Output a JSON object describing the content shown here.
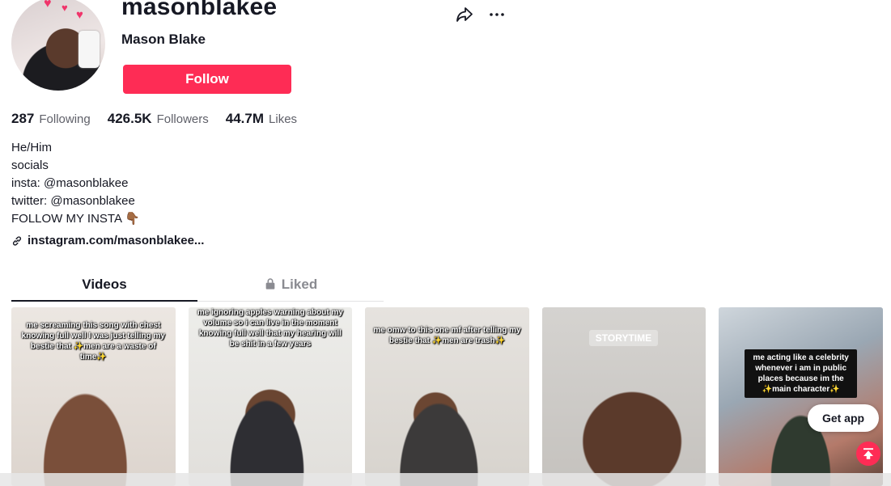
{
  "profile": {
    "username": "masonblakee",
    "nickname": "Mason Blake",
    "follow_label": "Follow"
  },
  "stats": {
    "following_count": "287",
    "following_label": "Following",
    "followers_count": "426.5K",
    "followers_label": "Followers",
    "likes_count": "44.7M",
    "likes_label": "Likes"
  },
  "bio": {
    "lines": [
      "He/Him",
      "socials",
      "insta: @masonblakee",
      "twitter: @masonblakee",
      "FOLLOW MY INSTA 👇🏾"
    ],
    "link": "instagram.com/masonblakee..."
  },
  "tabs": {
    "videos": "Videos",
    "liked": "Liked"
  },
  "videos": [
    {
      "caption": "me screaming this song with chest knowing full well I was just telling my bestie that ✨men are a waste of time✨"
    },
    {
      "caption": "me ignoring apples warning about my volume so i can live in the moment knowing full well that my hearing will be shit in a few years"
    },
    {
      "caption": "me omw to this one mf after telling my bestie that ✨men are trash✨"
    },
    {
      "caption": "",
      "badge": "STORYTIME"
    },
    {
      "caption": "me acting like a celebrity whenever i am in public places because im the ✨main character✨"
    }
  ],
  "floating": {
    "get_app": "Get app"
  },
  "icons": {
    "share": "share-icon",
    "more": "more-icon",
    "link": "link-icon",
    "lock": "lock-icon",
    "back_to_top": "back-to-top-icon"
  },
  "colors": {
    "accent": "#fe2c55",
    "text": "#161823",
    "muted": "#8a8b91"
  }
}
